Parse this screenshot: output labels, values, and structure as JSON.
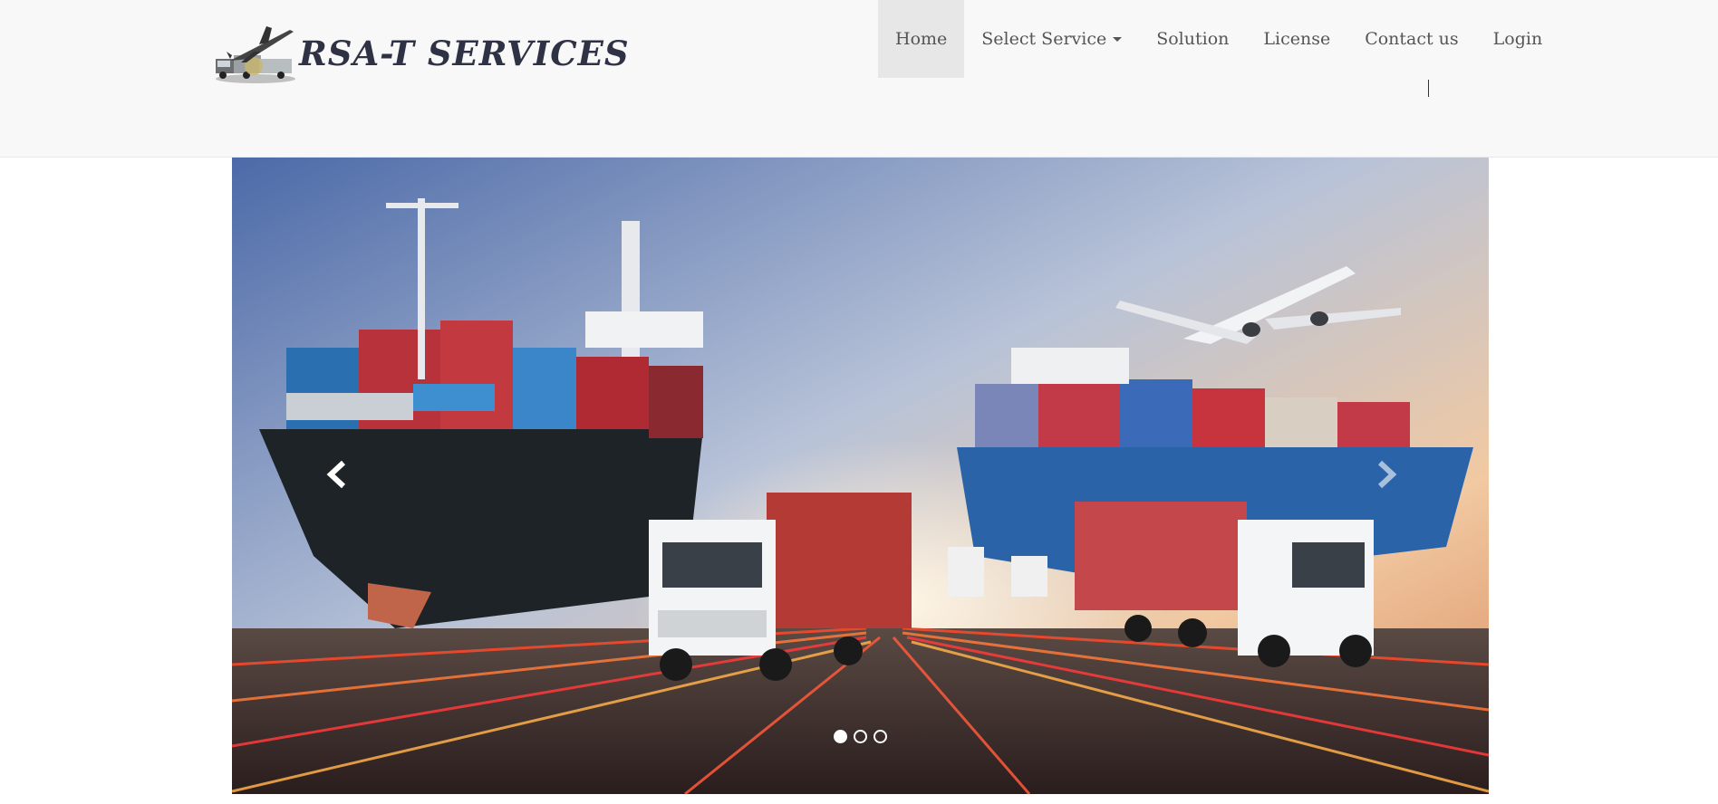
{
  "brand": {
    "name": "RSA-T SERVICES",
    "logo_icon": "airplane-truck-logo-icon"
  },
  "nav": {
    "items": [
      {
        "label": "Home",
        "active": true
      },
      {
        "label": "Select Service",
        "dropdown": true
      },
      {
        "label": "Solution"
      },
      {
        "label": "License"
      },
      {
        "label": "Contact us"
      },
      {
        "label": "Login"
      }
    ],
    "separator_text": "|"
  },
  "carousel": {
    "image_subject": "cargo ships, trucks and airplane logistics banner",
    "prev_icon": "chevron-left-icon",
    "next_icon": "chevron-right-icon",
    "slide_count": 3,
    "active_slide": 1
  },
  "colors": {
    "navbar_bg": "#f8f8f8",
    "active_nav_bg": "#e7e7e7",
    "brand_text": "#2f3145"
  }
}
